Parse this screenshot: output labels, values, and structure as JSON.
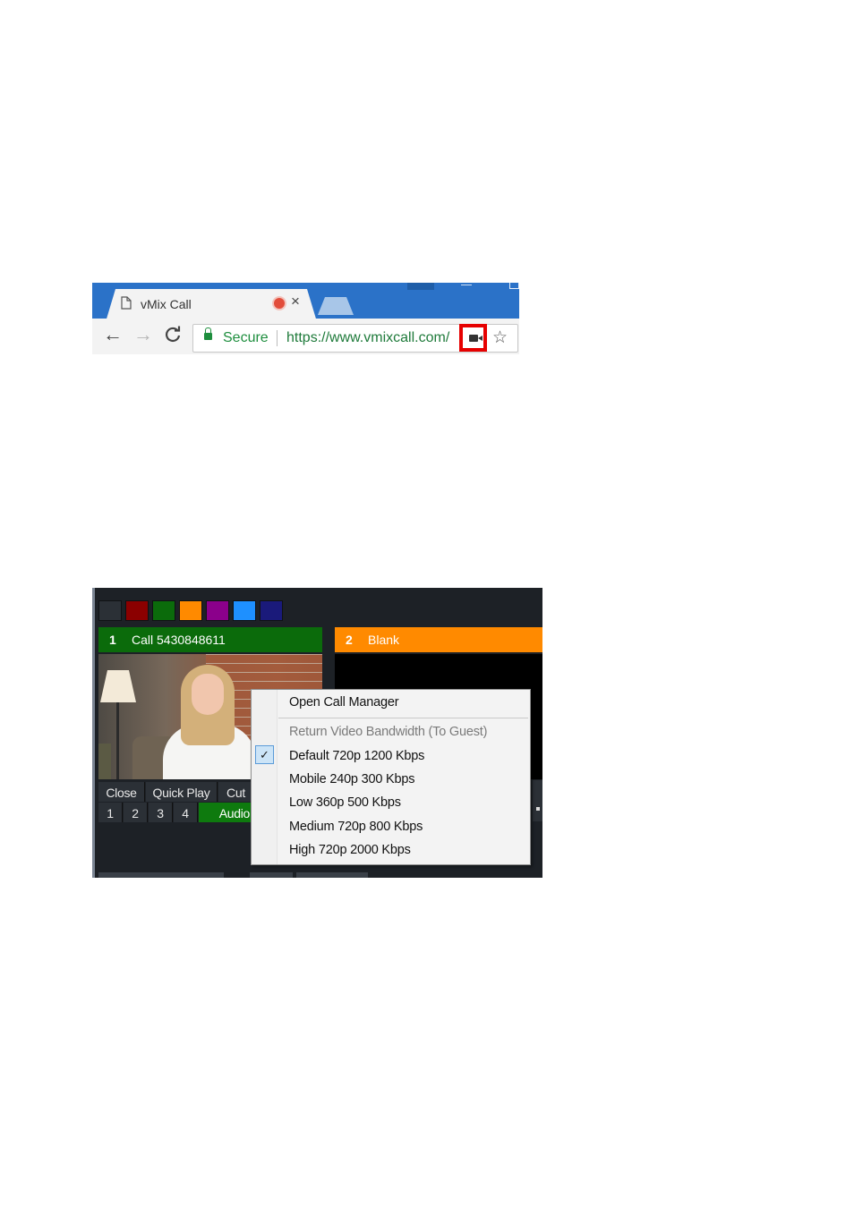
{
  "browser": {
    "tab_title": "vMix Call",
    "tab_close": "×",
    "back": "←",
    "forward": "→",
    "reload": "C",
    "secure_label": "Secure",
    "url": "https://www.vmixcall.com/",
    "icons": {
      "page": "page-icon",
      "recording": "recording-dot-icon",
      "lock": "lock-icon",
      "camera": "camera-icon",
      "star": "star-icon"
    },
    "colors": {
      "frame": "#2b72c8",
      "secure": "#1e8e3e",
      "highlight": "#e60000"
    }
  },
  "vmix": {
    "swatch_colors": [
      "#2b3036",
      "#8b0000",
      "#0b6b0b",
      "#ff8a00",
      "#8b008b",
      "#1e90ff",
      "#1a1a7a"
    ],
    "inputs": [
      {
        "number": "1",
        "name": "Call 5430848611",
        "color": "#0b6b0b"
      },
      {
        "number": "2",
        "name": "Blank",
        "color": "#ff8a00"
      }
    ],
    "buttons_row1": [
      "Close",
      "Quick Play",
      "Cut"
    ],
    "buttons_row2": [
      "1",
      "2",
      "3",
      "4",
      "Audio"
    ]
  },
  "context_menu": {
    "open_call_manager": "Open Call Manager",
    "section_header": "Return Video Bandwidth (To Guest)",
    "options": [
      {
        "label": "Default 720p 1200 Kbps",
        "checked": true
      },
      {
        "label": "Mobile 240p 300 Kbps",
        "checked": false
      },
      {
        "label": "Low 360p 500 Kbps",
        "checked": false
      },
      {
        "label": "Medium 720p 800 Kbps",
        "checked": false
      },
      {
        "label": "High 720p 2000 Kbps",
        "checked": false
      }
    ],
    "check_glyph": "✓"
  }
}
